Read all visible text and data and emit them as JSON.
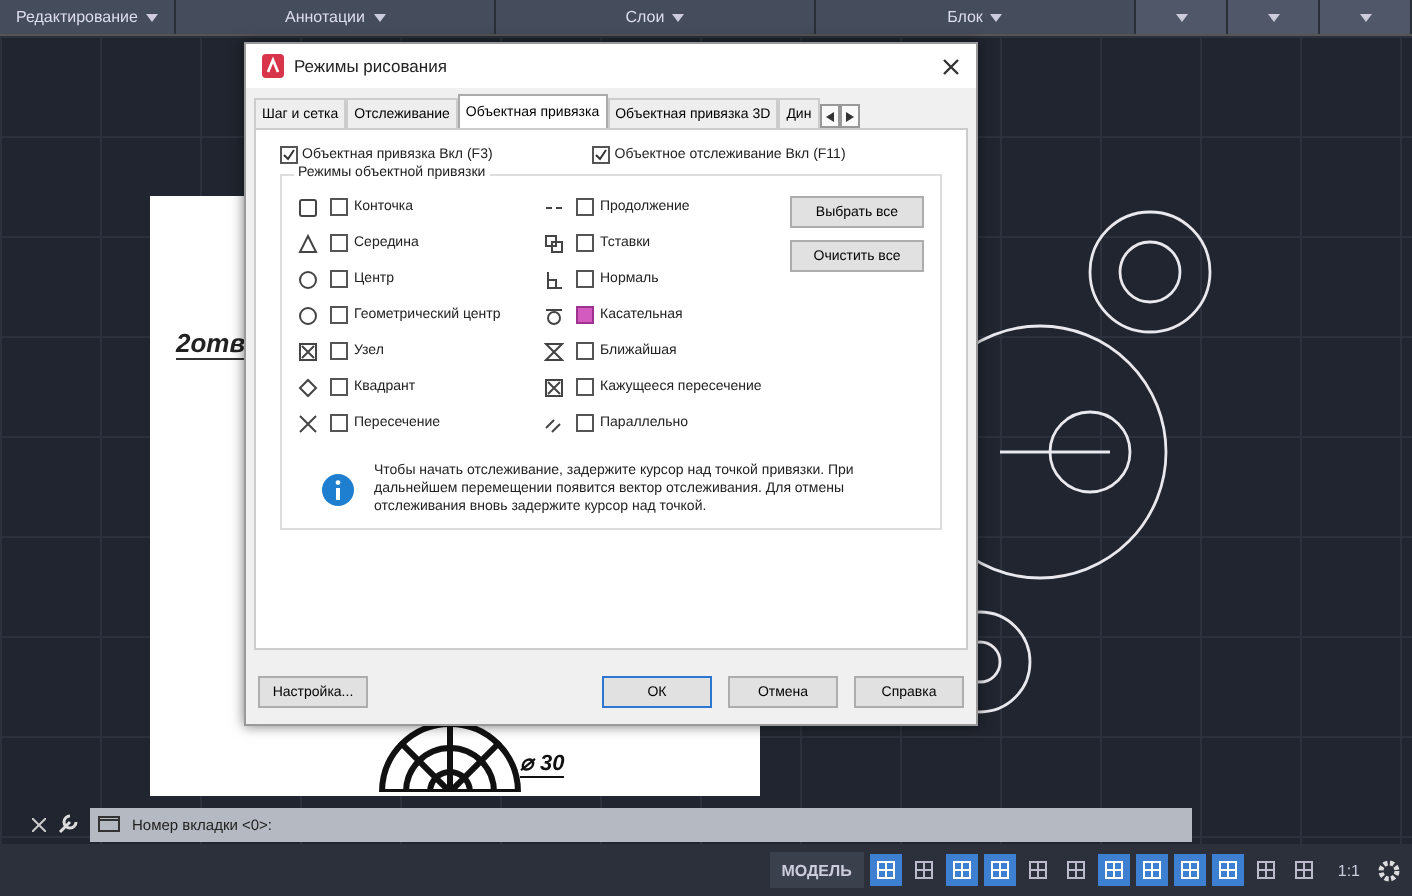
{
  "ribbon": {
    "panels": [
      {
        "label": "Редактирование"
      },
      {
        "label": "Аннотации"
      },
      {
        "label": "Слои"
      },
      {
        "label": "Блок"
      }
    ]
  },
  "drawing": {
    "note": "2отв",
    "dimension": "⌀ 30"
  },
  "dialog": {
    "title": "Режимы рисования",
    "tabs": [
      {
        "label": "Шаг и сетка",
        "selected": false
      },
      {
        "label": "Отслеживание",
        "selected": false
      },
      {
        "label": "Объектная привязка",
        "selected": true
      },
      {
        "label": "Объектная привязка 3D",
        "selected": false
      },
      {
        "label": "Дин",
        "selected": false
      }
    ],
    "toggles": [
      {
        "label": "Объектная привязка Вкл (F3)",
        "checked": true
      },
      {
        "label": "Объектное отслеживание Вкл (F11)",
        "checked": true
      }
    ],
    "group_title": "Режимы объектной привязки",
    "modes": [
      {
        "label": "Конточка",
        "checked": false,
        "hovered": false
      },
      {
        "label": "Середина",
        "checked": false,
        "hovered": false
      },
      {
        "label": "Центр",
        "checked": false,
        "hovered": false
      },
      {
        "label": "Геометрический центр",
        "checked": false,
        "hovered": false
      },
      {
        "label": "Узел",
        "checked": false,
        "hovered": false
      },
      {
        "label": "Квадрант",
        "checked": false,
        "hovered": false
      },
      {
        "label": "Пересечение",
        "checked": false,
        "hovered": false
      },
      {
        "label": "Продолжение",
        "checked": false,
        "hovered": false
      },
      {
        "label": "Тставки",
        "checked": false,
        "hovered": false
      },
      {
        "label": "Нормаль",
        "checked": false,
        "hovered": false
      },
      {
        "label": "Касательная",
        "checked": false,
        "hovered": true
      },
      {
        "label": "Ближайшая",
        "checked": false,
        "hovered": false
      },
      {
        "label": "Кажущееся пересечение",
        "checked": false,
        "hovered": false
      },
      {
        "label": "Параллельно",
        "checked": false,
        "hovered": false
      }
    ],
    "select_all": "Выбрать все",
    "clear_all": "Очистить все",
    "info": "Чтобы начать отслеживание, задержите курсор над точкой привязки. При дальнейшем перемещении появится вектор отслеживания. Для отмены отслеживания вновь задержите курсор над точкой.",
    "buttons": [
      {
        "label": "Настройка...",
        "kind": "left"
      },
      {
        "label": "ОК",
        "kind": "default"
      },
      {
        "label": "Отмена",
        "kind": "normal"
      },
      {
        "label": "Справка",
        "kind": "normal"
      }
    ]
  },
  "command_line": {
    "prompt": "Номер вкладки <0>:"
  },
  "status_bar": {
    "model": "МОДЕЛЬ",
    "scale": "1:1",
    "toggles": [
      {
        "on": true
      },
      {
        "on": false
      },
      {
        "on": true
      },
      {
        "on": true
      },
      {
        "on": false
      },
      {
        "on": false
      },
      {
        "on": true
      },
      {
        "on": true
      },
      {
        "on": true
      },
      {
        "on": true
      },
      {
        "on": false
      },
      {
        "on": false
      }
    ]
  }
}
